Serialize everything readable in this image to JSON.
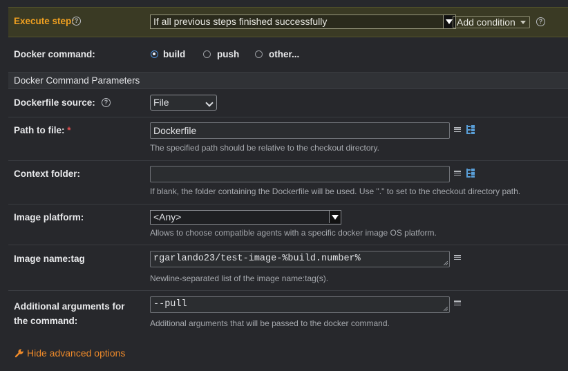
{
  "execute_step": {
    "label": "Execute step:",
    "selected": "If all previous steps finished successfully",
    "add_condition": "Add condition"
  },
  "docker_command": {
    "label": "Docker command:",
    "options": [
      "build",
      "push",
      "other..."
    ],
    "selected": "build"
  },
  "section_title": "Docker Command Parameters",
  "dockerfile_source": {
    "label": "Dockerfile source:",
    "selected": "File"
  },
  "path_to_file": {
    "label": "Path to file:",
    "required_mark": "*",
    "value": "Dockerfile",
    "hint": "The specified path should be relative to the checkout directory."
  },
  "context_folder": {
    "label": "Context folder:",
    "value": "",
    "hint": "If blank, the folder containing the Dockerfile will be used. Use \".\" to set to the checkout directory path."
  },
  "image_platform": {
    "label": "Image platform:",
    "selected": "<Any>",
    "hint": "Allows to choose compatible agents with a specific docker image OS platform."
  },
  "image_name_tag": {
    "label": "Image name:tag",
    "value": "rgarlando23/test-image-%build.number%",
    "hint": "Newline-separated list of the image name:tag(s)."
  },
  "additional_args": {
    "label_line1": "Additional arguments for",
    "label_line2": "the command:",
    "value": "--pull",
    "hint": "Additional arguments that will be passed to the docker command."
  },
  "advanced_link": "Hide advanced options",
  "colors": {
    "background": "#27282c",
    "highlight_row": "#3a3a24",
    "execute_label": "#f0a020",
    "link": "#ee8a2a",
    "required": "#e05050",
    "radio_accent": "#4e8fd9"
  }
}
